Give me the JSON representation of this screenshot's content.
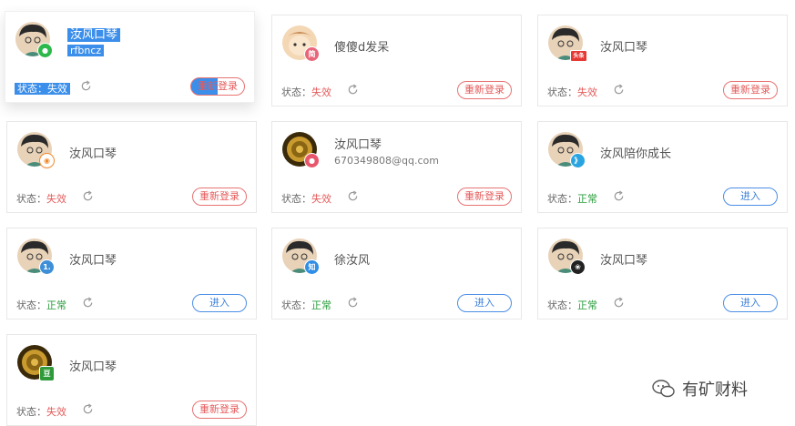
{
  "status_label": "状态：",
  "accounts": [
    {
      "name": "汝风口琴",
      "sub": "rfbncz",
      "status": "失效",
      "status_type": "bad",
      "button": "重新登录",
      "badge": "wechat-icon",
      "badge_text": "",
      "badge_color": "#2db84c",
      "face_color": "#e8d2b8"
    },
    {
      "name": "傻傻d发呆",
      "sub": "",
      "status": "失效",
      "status_type": "bad",
      "button": "重新登录",
      "badge": "jian-icon",
      "badge_text": "简",
      "badge_color": "#e8667a",
      "face_color": "#f2c9a0"
    },
    {
      "name": "汝风口琴",
      "sub": "",
      "status": "失效",
      "status_type": "bad",
      "button": "重新登录",
      "badge": "toutiao-icon",
      "badge_text": "头条",
      "badge_color": "#e53935",
      "face_color": "#e8d2b8"
    },
    {
      "name": "汝风口琴",
      "sub": "",
      "status": "失效",
      "status_type": "bad",
      "button": "重新登录",
      "badge": "weibo-icon",
      "badge_text": "",
      "badge_color": "#f08a2c",
      "face_color": "#e8d2b8"
    },
    {
      "name": "汝风口琴",
      "sub": "670349808@qq.com",
      "status": "失效",
      "status_type": "bad",
      "button": "重新登录",
      "badge": "sohu-icon",
      "badge_text": "",
      "badge_color": "#e8566b",
      "face_color": "#6a4a12"
    },
    {
      "name": "汝风陪你成长",
      "sub": "",
      "status": "正常",
      "status_type": "ok",
      "button": "进入",
      "badge": "dayu-icon",
      "badge_text": "",
      "badge_color": "#2aa4e0",
      "face_color": "#e8d2b8"
    },
    {
      "name": "汝风口琴",
      "sub": "",
      "status": "正常",
      "status_type": "ok",
      "button": "进入",
      "badge": "yidian-icon",
      "badge_text": "1.",
      "badge_color": "#3f8fd8",
      "face_color": "#e8d2b8"
    },
    {
      "name": "徐汝风",
      "sub": "",
      "status": "正常",
      "status_type": "ok",
      "button": "进入",
      "badge": "zhihu-icon",
      "badge_text": "知",
      "badge_color": "#2f8ee6",
      "face_color": "#e8d2b8"
    },
    {
      "name": "汝风口琴",
      "sub": "",
      "status": "正常",
      "status_type": "ok",
      "button": "进入",
      "badge": "baijia-icon",
      "badge_text": "",
      "badge_color": "#222222",
      "face_color": "#e8d2b8"
    },
    {
      "name": "汝风口琴",
      "sub": "",
      "status": "失效",
      "status_type": "bad",
      "button": "重新登录",
      "badge": "douban-icon",
      "badge_text": "豆",
      "badge_color": "#2e9a3a",
      "face_color": "#6a4a12"
    }
  ],
  "watermark": "有矿财料"
}
